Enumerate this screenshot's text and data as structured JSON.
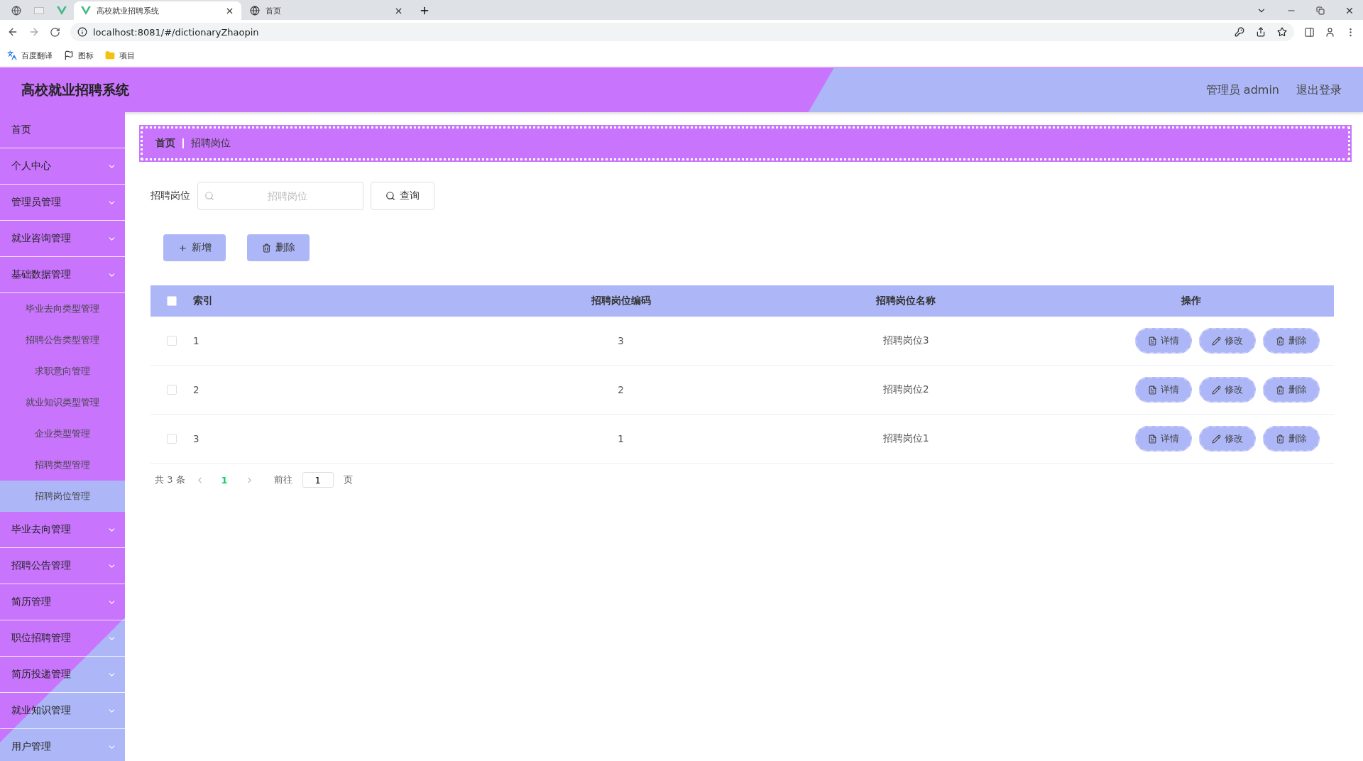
{
  "browser": {
    "tabs": [
      {
        "title": "高校就业招聘系统",
        "selected": true,
        "kind": "vue"
      },
      {
        "title": "首页",
        "selected": false,
        "kind": "globe"
      }
    ],
    "address": "localhost:8081/#/dictionaryZhaopin",
    "bookmarks": [
      {
        "label": "百度翻译",
        "kind": "translate"
      },
      {
        "label": "图标",
        "kind": "flag"
      },
      {
        "label": "项目",
        "kind": "folder"
      }
    ]
  },
  "header": {
    "title": "高校就业招聘系统",
    "user": "管理员 admin",
    "logout": "退出登录"
  },
  "sidebar": {
    "items": [
      {
        "label": "首页",
        "kind": "link"
      },
      {
        "label": "个人中心",
        "kind": "menu"
      },
      {
        "label": "管理员管理",
        "kind": "menu"
      },
      {
        "label": "就业咨询管理",
        "kind": "menu"
      },
      {
        "label": "基础数据管理",
        "kind": "menu",
        "children": [
          {
            "label": "毕业去向类型管理",
            "selected": false
          },
          {
            "label": "招聘公告类型管理",
            "selected": false
          },
          {
            "label": "求职意向管理",
            "selected": false
          },
          {
            "label": "就业知识类型管理",
            "selected": false
          },
          {
            "label": "企业类型管理",
            "selected": false
          },
          {
            "label": "招聘类型管理",
            "selected": false
          },
          {
            "label": "招聘岗位管理",
            "selected": true
          }
        ]
      },
      {
        "label": "毕业去向管理",
        "kind": "menu"
      },
      {
        "label": "招聘公告管理",
        "kind": "menu"
      },
      {
        "label": "简历管理",
        "kind": "menu"
      },
      {
        "label": "职位招聘管理",
        "kind": "menu"
      },
      {
        "label": "简历投递管理",
        "kind": "menu"
      },
      {
        "label": "就业知识管理",
        "kind": "menu"
      },
      {
        "label": "用户管理",
        "kind": "menu"
      }
    ]
  },
  "breadcrumb": [
    "首页",
    "招聘岗位"
  ],
  "search": {
    "label": "招聘岗位",
    "placeholder": "招聘岗位",
    "button": "查询"
  },
  "actions": [
    {
      "label": "新增",
      "kind": "add"
    },
    {
      "label": "删除",
      "kind": "delete"
    }
  ],
  "table": {
    "header_checked": false,
    "columns": [
      "索引",
      "招聘岗位编码",
      "招聘岗位名称",
      "操作"
    ],
    "rows": [
      {
        "checked": false,
        "cells": [
          "1",
          "3",
          "招聘岗位3"
        ],
        "actions": [
          {
            "label": "详情",
            "kind": "detail"
          },
          {
            "label": "修改",
            "kind": "edit"
          },
          {
            "label": "删除",
            "kind": "delete"
          }
        ]
      },
      {
        "checked": false,
        "cells": [
          "2",
          "2",
          "招聘岗位2"
        ],
        "actions": [
          {
            "label": "详情",
            "kind": "detail"
          },
          {
            "label": "修改",
            "kind": "edit"
          },
          {
            "label": "删除",
            "kind": "delete"
          }
        ]
      },
      {
        "checked": false,
        "cells": [
          "3",
          "1",
          "招聘岗位1"
        ],
        "actions": [
          {
            "label": "详情",
            "kind": "detail"
          },
          {
            "label": "修改",
            "kind": "edit"
          },
          {
            "label": "删除",
            "kind": "delete"
          }
        ]
      }
    ]
  },
  "pagination": {
    "total": "共 3 条",
    "pages": [
      {
        "label": "1",
        "selected": true
      }
    ],
    "goto_prefix": "前往",
    "goto_value": "1",
    "goto_suffix": "页"
  }
}
